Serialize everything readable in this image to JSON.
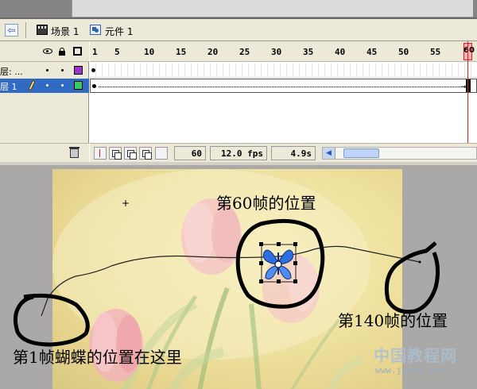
{
  "breadcrumb": {
    "scene_label": "场景 1",
    "symbol_label": "元件 1"
  },
  "timeline": {
    "layers": [
      {
        "name": "层: ...",
        "color": "#9b33cc"
      },
      {
        "name": "层 1",
        "color": "#33cc66"
      }
    ],
    "ruler_ticks": [
      "1",
      "5",
      "10",
      "15",
      "20",
      "25",
      "30",
      "35",
      "40",
      "45",
      "50",
      "55",
      "60"
    ],
    "current_frame": "60",
    "frame_rate": "12.0 fps",
    "elapsed_time": "4.9s"
  },
  "stage": {
    "annotation_frame60": "第60帧的位置",
    "annotation_frame140": "第140帧的位置",
    "annotation_frame1": "第1帧蝴蝶的位置在这里"
  },
  "watermark": {
    "brand": "中国教程网",
    "url": "www.jcwcn.com"
  }
}
